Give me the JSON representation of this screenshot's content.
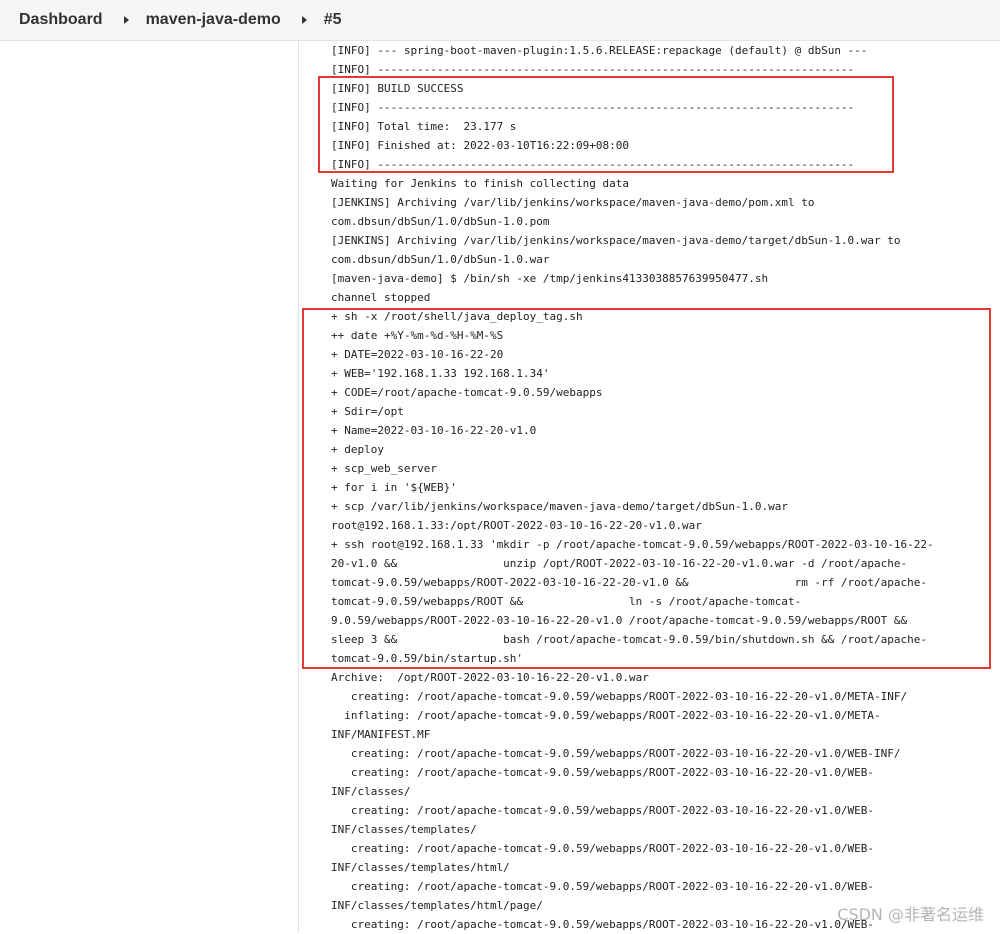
{
  "breadcrumb": {
    "items": [
      "Dashboard",
      "maven-java-demo",
      "#5"
    ]
  },
  "console": {
    "lines": [
      "[INFO] --- spring-boot-maven-plugin:1.5.6.RELEASE:repackage (default) @ dbSun ---",
      "[INFO] ------------------------------------------------------------------------",
      "[INFO] BUILD SUCCESS",
      "[INFO] ------------------------------------------------------------------------",
      "[INFO] Total time:  23.177 s",
      "[INFO] Finished at: 2022-03-10T16:22:09+08:00",
      "[INFO] ------------------------------------------------------------------------",
      "Waiting for Jenkins to finish collecting data",
      "[JENKINS] Archiving /var/lib/jenkins/workspace/maven-java-demo/pom.xml to",
      "com.dbsun/dbSun/1.0/dbSun-1.0.pom",
      "[JENKINS] Archiving /var/lib/jenkins/workspace/maven-java-demo/target/dbSun-1.0.war to",
      "com.dbsun/dbSun/1.0/dbSun-1.0.war",
      "[maven-java-demo] $ /bin/sh -xe /tmp/jenkins4133038857639950477.sh",
      "channel stopped",
      "+ sh -x /root/shell/java_deploy_tag.sh",
      "++ date +%Y-%m-%d-%H-%M-%S",
      "+ DATE=2022-03-10-16-22-20",
      "+ WEB='192.168.1.33 192.168.1.34'",
      "+ CODE=/root/apache-tomcat-9.0.59/webapps",
      "+ Sdir=/opt",
      "+ Name=2022-03-10-16-22-20-v1.0",
      "+ deploy",
      "+ scp_web_server",
      "+ for i in '${WEB}'",
      "+ scp /var/lib/jenkins/workspace/maven-java-demo/target/dbSun-1.0.war",
      "root@192.168.1.33:/opt/ROOT-2022-03-10-16-22-20-v1.0.war",
      "+ ssh root@192.168.1.33 'mkdir -p /root/apache-tomcat-9.0.59/webapps/ROOT-2022-03-10-16-22-",
      "20-v1.0 &&                unzip /opt/ROOT-2022-03-10-16-22-20-v1.0.war -d /root/apache-",
      "tomcat-9.0.59/webapps/ROOT-2022-03-10-16-22-20-v1.0 &&                rm -rf /root/apache-",
      "tomcat-9.0.59/webapps/ROOT &&                ln -s /root/apache-tomcat-",
      "9.0.59/webapps/ROOT-2022-03-10-16-22-20-v1.0 /root/apache-tomcat-9.0.59/webapps/ROOT &&",
      "sleep 3 &&                bash /root/apache-tomcat-9.0.59/bin/shutdown.sh && /root/apache-",
      "tomcat-9.0.59/bin/startup.sh'",
      "Archive:  /opt/ROOT-2022-03-10-16-22-20-v1.0.war",
      "   creating: /root/apache-tomcat-9.0.59/webapps/ROOT-2022-03-10-16-22-20-v1.0/META-INF/",
      "  inflating: /root/apache-tomcat-9.0.59/webapps/ROOT-2022-03-10-16-22-20-v1.0/META-",
      "INF/MANIFEST.MF",
      "   creating: /root/apache-tomcat-9.0.59/webapps/ROOT-2022-03-10-16-22-20-v1.0/WEB-INF/",
      "   creating: /root/apache-tomcat-9.0.59/webapps/ROOT-2022-03-10-16-22-20-v1.0/WEB-",
      "INF/classes/",
      "   creating: /root/apache-tomcat-9.0.59/webapps/ROOT-2022-03-10-16-22-20-v1.0/WEB-",
      "INF/classes/templates/",
      "   creating: /root/apache-tomcat-9.0.59/webapps/ROOT-2022-03-10-16-22-20-v1.0/WEB-",
      "INF/classes/templates/html/",
      "   creating: /root/apache-tomcat-9.0.59/webapps/ROOT-2022-03-10-16-22-20-v1.0/WEB-",
      "INF/classes/templates/html/page/",
      "   creating: /root/apache-tomcat-9.0.59/webapps/ROOT-2022-03-10-16-22-20-v1.0/WEB-"
    ]
  },
  "highlight_color": "#e53935",
  "watermark": "CSDN @非著名运维"
}
